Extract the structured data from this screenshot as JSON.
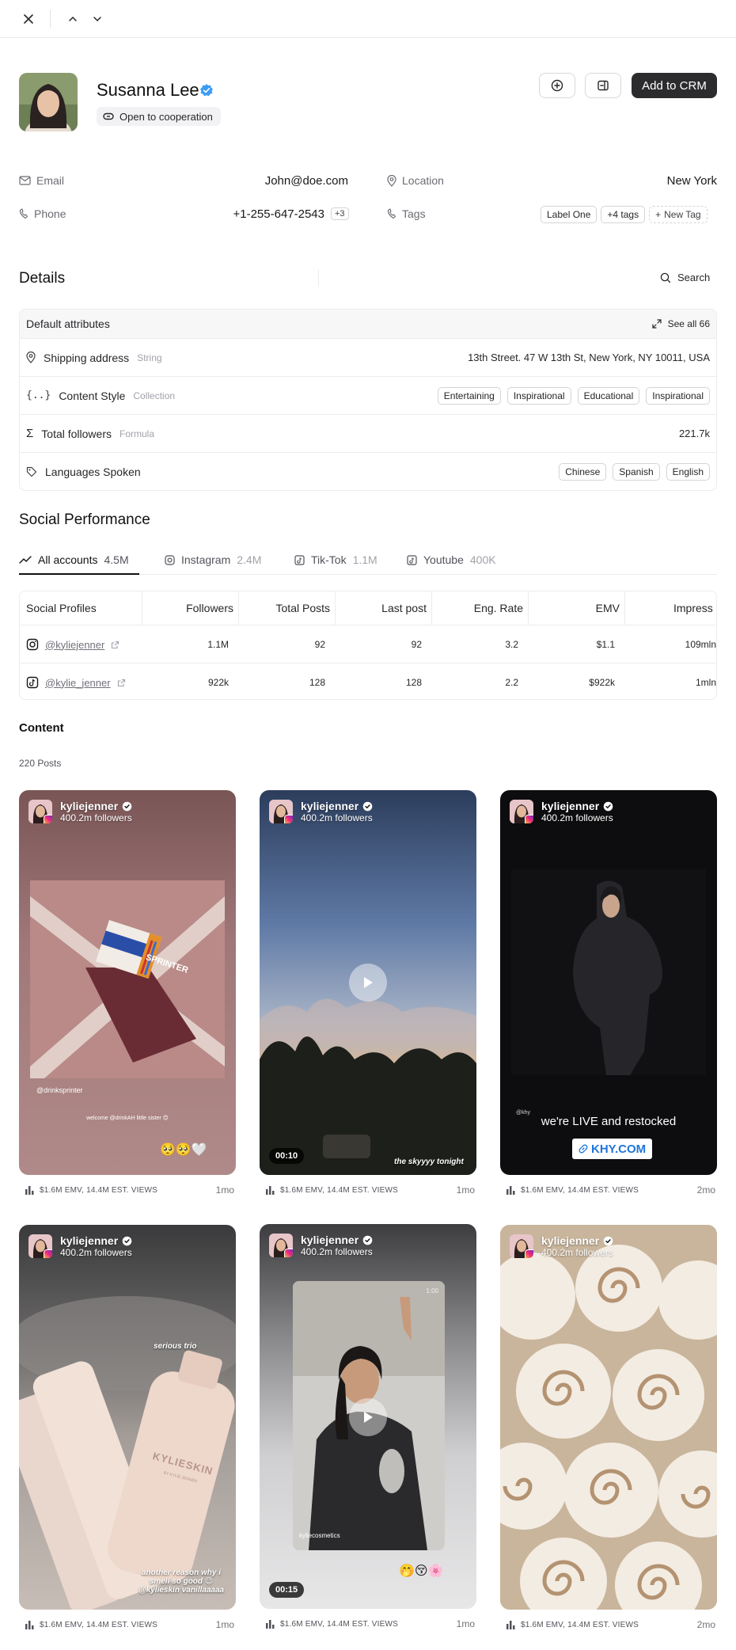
{
  "profile": {
    "name": "Susanna Lee",
    "cooperation": "Open to cooperation",
    "add_to_crm": "Add to CRM"
  },
  "contact": {
    "email_label": "Email",
    "email": "John@doe.com",
    "phone_label": "Phone",
    "phone": "+1-255-647-2543",
    "phone_extra": "+3",
    "location_label": "Location",
    "location": "New York",
    "tags_label": "Tags",
    "tags": [
      "Label One",
      "+4 tags"
    ],
    "new_tag": "New Tag"
  },
  "details": {
    "title": "Details",
    "search": "Search",
    "default_attributes": "Default attributes",
    "see_all": "See all 66",
    "attributes": [
      {
        "name": "Shipping address",
        "type": "String",
        "value": "13th Street. 47 W 13th St, New York, NY 10011, USA"
      },
      {
        "name": "Content Style",
        "type": "Collection",
        "chips": [
          "Entertaining",
          "Inspirational",
          "Educational",
          "Inspirational"
        ]
      },
      {
        "name": "Total followers",
        "type": "Formula",
        "value": "221.7k"
      },
      {
        "name": "Languages Spoken",
        "type": "",
        "chips": [
          "Chinese",
          "Spanish",
          "English"
        ]
      }
    ]
  },
  "social": {
    "title": "Social Performance",
    "tabs": [
      {
        "label": "All accounts",
        "count": "4.5M"
      },
      {
        "label": "Instagram",
        "count": "2.4M"
      },
      {
        "label": "Tik-Tok",
        "count": "1.1M"
      },
      {
        "label": "Youtube",
        "count": "400K"
      }
    ],
    "columns": [
      "Social Profiles",
      "Followers",
      "Total Posts",
      "Last post",
      "Eng. Rate",
      "EMV",
      "Impress"
    ],
    "rows": [
      {
        "handle": "@kyliejenner",
        "followers": "1.1M",
        "total_posts": "92",
        "last_post": "92",
        "eng_rate": "3.2",
        "emv": "$1.1",
        "impressions": "109mln"
      },
      {
        "handle": "@kylie_jenner",
        "followers": "922k",
        "total_posts": "128",
        "last_post": "128",
        "eng_rate": "2.2",
        "emv": "$922k",
        "impressions": "1mln"
      }
    ]
  },
  "content": {
    "title": "Content",
    "count": "220 Posts",
    "posts": [
      {
        "user": "kyliejenner",
        "followers": "400.2m followers",
        "meta": "$1.6M EMV, 14.4M EST. VIEWS",
        "ago": "1mo",
        "text1": "@drinksprinter",
        "text2": "welcome @drinkAH little sister 😊",
        "emoji": "🥺🥺🤍",
        "box_text": "SPRINTER"
      },
      {
        "user": "kyliejenner",
        "followers": "400.2m followers",
        "meta": "$1.6M EMV, 14.4M EST. VIEWS",
        "ago": "1mo",
        "duration": "00:10",
        "caption": "the skyyyy tonight"
      },
      {
        "user": "kyliejenner",
        "followers": "400.2m followers",
        "meta": "$1.6M EMV, 14.4M EST. VIEWS",
        "ago": "2mo",
        "small": "@khy",
        "live": "we're LIVE and restocked",
        "link": "KHY.COM"
      },
      {
        "user": "kyliejenner",
        "followers": "400.2m followers",
        "meta": "$1.6M EMV, 14.4M EST. VIEWS",
        "ago": "1mo",
        "caption_top": "serious trio",
        "caption": "another reason why i smell so good 😉 @kylieskin vanillaaaaa",
        "brand": "KYLIESKIN",
        "brand_sub": "BY KYLIE JENNER"
      },
      {
        "user": "kyliejenner",
        "followers": "400.2m followers",
        "meta": "$1.6M EMV, 14.4M EST. VIEWS",
        "ago": "1mo",
        "duration": "00:15",
        "inner_label": "kyliecosmetics",
        "inner_time": "1:00",
        "emoji": "🤭😚🌸"
      },
      {
        "user": "kyliejenner",
        "followers": "400.2m followers",
        "meta": "$1.6M EMV, 14.4M EST. VIEWS",
        "ago": "2mo"
      }
    ]
  },
  "colors": {
    "accent_dark": "#2c2c2e",
    "verified_blue": "#3b9cf5"
  }
}
